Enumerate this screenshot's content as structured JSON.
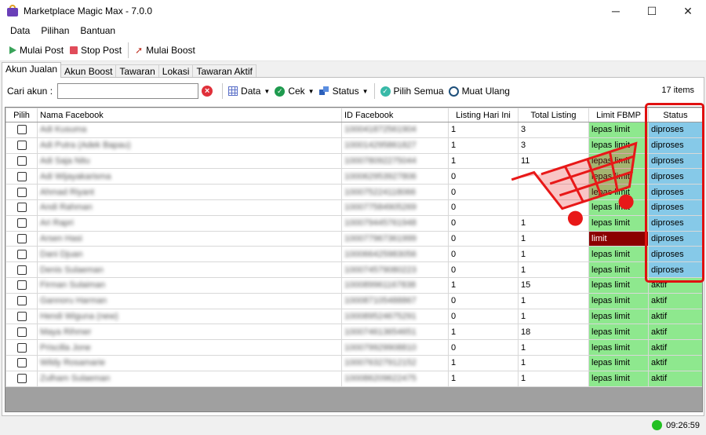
{
  "window": {
    "title": "Marketplace Magic Max - 7.0.0",
    "minimize": "─",
    "maximize": "☐",
    "close": "✕"
  },
  "menu": [
    "Data",
    "Pilihan",
    "Bantuan"
  ],
  "toolbar": {
    "start_post": "Mulai Post",
    "stop_post": "Stop Post",
    "start_boost": "Mulai Boost"
  },
  "tabs": [
    "Akun Jualan",
    "Akun Boost",
    "Tawaran",
    "Lokasi",
    "Tawaran Aktif"
  ],
  "filter": {
    "search_label": "Cari akun :",
    "search_value": "",
    "data_btn": "Data",
    "cek_btn": "Cek",
    "status_btn": "Status",
    "pilih_semua": "Pilih Semua",
    "muat_ulang": "Muat Ulang",
    "items_count": "17 items"
  },
  "table": {
    "headers": [
      "Pilih",
      "Nama Facebook",
      "ID Facebook",
      "Listing Hari Ini",
      "Total Listing",
      "Limit FBMP",
      "Status"
    ],
    "rows": [
      {
        "name": "Adi Kusuma",
        "id": "100041872561904",
        "today": "1",
        "total": "3",
        "limit": "lepas limit",
        "status": "diproses"
      },
      {
        "name": "Adi Putra (Adek Bapau)",
        "id": "100014295861827",
        "today": "1",
        "total": "3",
        "limit": "lepas limit",
        "status": "diproses"
      },
      {
        "name": "Adi Saja Nitu",
        "id": "100078092275044",
        "today": "1",
        "total": "11",
        "limit": "lepas limit",
        "status": "diproses"
      },
      {
        "name": "Adi Wijayakarisma",
        "id": "100062953927806",
        "today": "0",
        "total": "",
        "limit": "lepas limit",
        "status": "diproses"
      },
      {
        "name": "Ahmad Riyant",
        "id": "100075224118066",
        "today": "0",
        "total": "",
        "limit": "lepas limit",
        "status": "diproses"
      },
      {
        "name": "Andi Rahman",
        "id": "100077584905269",
        "today": "0",
        "total": "",
        "limit": "lepas limit",
        "status": "diproses"
      },
      {
        "name": "Ari Rapri",
        "id": "100079445761948",
        "today": "0",
        "total": "1",
        "limit": "lepas limit",
        "status": "diproses"
      },
      {
        "name": "Arsen Hasi",
        "id": "100077967361999",
        "today": "0",
        "total": "1",
        "limit": "limit",
        "status": "diproses"
      },
      {
        "name": "Dani Djuan",
        "id": "100066425983056",
        "today": "0",
        "total": "1",
        "limit": "lepas limit",
        "status": "diproses"
      },
      {
        "name": "Denis Sulaeman",
        "id": "100074579080223",
        "today": "0",
        "total": "1",
        "limit": "lepas limit",
        "status": "diproses"
      },
      {
        "name": "Firman Sulaiman",
        "id": "100089961167838",
        "today": "1",
        "total": "15",
        "limit": "lepas limit",
        "status": "aktif"
      },
      {
        "name": "Gannoru Harman",
        "id": "100087105488867",
        "today": "0",
        "total": "1",
        "limit": "lepas limit",
        "status": "aktif"
      },
      {
        "name": "Hendi Wiguna (new)",
        "id": "100089524675291",
        "today": "0",
        "total": "1",
        "limit": "lepas limit",
        "status": "aktif"
      },
      {
        "name": "Maya Rihmer",
        "id": "100074613654651",
        "today": "1",
        "total": "18",
        "limit": "lepas limit",
        "status": "aktif"
      },
      {
        "name": "Priscilla Jone",
        "id": "100079929908810",
        "today": "0",
        "total": "1",
        "limit": "lepas limit",
        "status": "aktif"
      },
      {
        "name": "Wildy Rosamarie",
        "id": "100076327912152",
        "today": "1",
        "total": "1",
        "limit": "lepas limit",
        "status": "aktif"
      },
      {
        "name": "Zulham Sulaeman",
        "id": "100086209622475",
        "today": "1",
        "total": "1",
        "limit": "lepas limit",
        "status": "aktif"
      }
    ]
  },
  "statusbar": {
    "time": "09:26:59"
  },
  "colors": {
    "limit_ok": "#8ee88e",
    "limit_bad": "#8b0000",
    "status_proses": "#86c9e8",
    "status_aktif": "#8ee88e",
    "highlight": "#e01010",
    "cart": "#e81818"
  },
  "icons": {
    "app": "shopping-bag-icon",
    "start": "play-icon",
    "stop": "stop-square-icon",
    "boost": "rocket-icon",
    "clear": "clear-x-icon",
    "data": "grid-icon",
    "cek": "check-circle-icon",
    "status": "status-icon",
    "pilih": "check-circle-teal-icon",
    "reload": "reload-icon",
    "cart": "shopping-cart-icon"
  }
}
